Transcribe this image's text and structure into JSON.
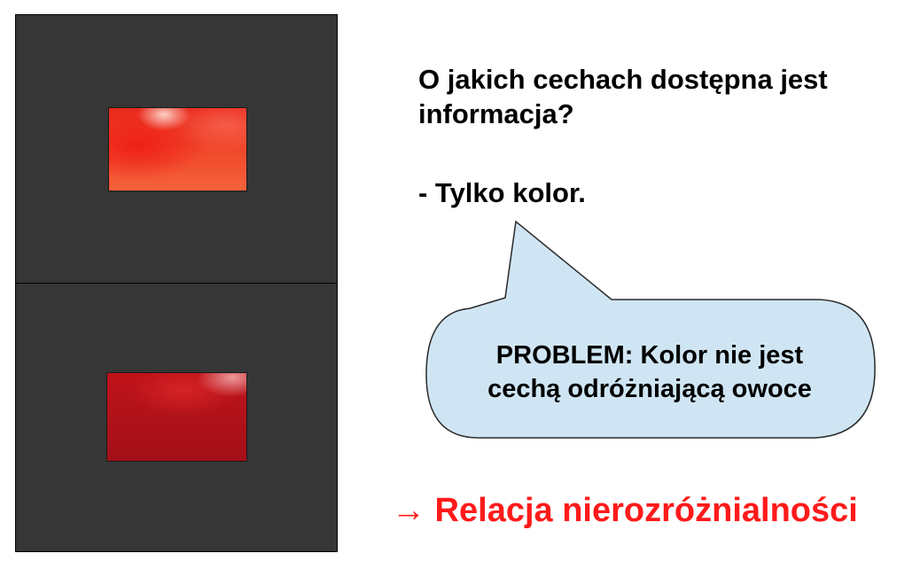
{
  "colors": {
    "panel_background": "#363636",
    "callout_fill": "#cfe5f3",
    "callout_stroke": "#2b2b2b",
    "conclusion_text": "#ff1a1a",
    "swatch_top": "#ec3a24",
    "swatch_bottom": "#b3121a"
  },
  "images": {
    "top": "red-fruit-color-patch",
    "bottom": "dark-red-fruit-color-patch"
  },
  "question": "O jakich cechach dostępna jest informacja?",
  "answer": "- Tylko kolor.",
  "callout": {
    "line1": "PROBLEM: Kolor nie jest",
    "line2": "cechą odróżniającą owoce"
  },
  "conclusion": "→ Relacja nierozróżnialności"
}
